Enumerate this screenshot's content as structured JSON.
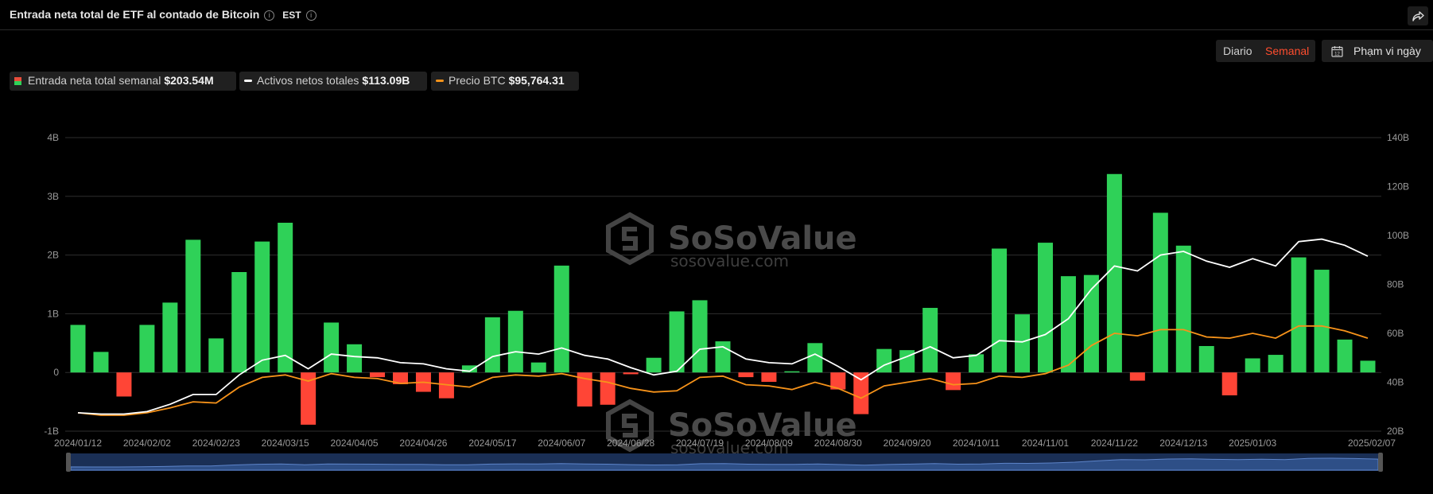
{
  "header": {
    "title": "Entrada neta total de ETF al contado de Bitcoin",
    "timezone": "EST"
  },
  "controls": {
    "daily_label": "Diario",
    "weekly_label": "Semanal",
    "range_label": "Phạm vi ngày",
    "active_color": "#ff4d2e"
  },
  "legend": [
    {
      "label": "Entrada neta total semanal",
      "value": "$203.54M"
    },
    {
      "label": "Activos netos totales",
      "value": "$113.09B"
    },
    {
      "label": "Precio BTC",
      "value": "$95,764.31"
    }
  ],
  "watermark": {
    "brand": "SoSoValue",
    "site": "sosovalue.com"
  },
  "chart_data": {
    "type": "bar",
    "combo": "bar+line",
    "grid": true,
    "legend_position": "top-left",
    "colors": {
      "positive": "#2fd158",
      "negative": "#ff4536",
      "net_assets": "#ffffff",
      "btc_price": "#f7931a"
    },
    "left_axis": {
      "ticks": [
        "4B",
        "3B",
        "2B",
        "1B",
        "0",
        "-1B"
      ],
      "min": -1,
      "max": 4,
      "unit": "B"
    },
    "right_axis": {
      "ticks": [
        "140B",
        "120B",
        "100B",
        "80B",
        "60B",
        "40B",
        "20B"
      ],
      "min": 20,
      "max": 140,
      "unit": "B"
    },
    "x_tick_labels": [
      "2024/01/12",
      "2024/02/02",
      "2024/02/23",
      "2024/03/15",
      "2024/04/05",
      "2024/04/26",
      "2024/05/17",
      "2024/06/07",
      "2024/06/28",
      "2024/07/19",
      "2024/08/09",
      "2024/08/30",
      "2024/09/20",
      "2024/10/11",
      "2024/11/01",
      "2024/11/22",
      "2024/12/13",
      "2025/01/03",
      "2025/02/07"
    ],
    "x_tick_weeks": [
      0,
      3,
      6,
      9,
      12,
      15,
      18,
      21,
      24,
      27,
      30,
      33,
      36,
      39,
      42,
      45,
      48,
      51,
      56
    ],
    "series": [
      {
        "name": "Entrada neta total semanal",
        "axis": "left",
        "values": [
          0.81,
          0.35,
          -0.41,
          0.81,
          1.19,
          2.26,
          0.58,
          1.71,
          2.23,
          2.55,
          -0.89,
          0.85,
          0.48,
          -0.08,
          -0.2,
          -0.33,
          -0.44,
          0.12,
          0.94,
          1.05,
          0.17,
          1.82,
          -0.58,
          -0.55,
          -0.03,
          0.25,
          1.04,
          1.23,
          0.53,
          -0.08,
          -0.16,
          0.02,
          0.5,
          -0.29,
          -0.71,
          0.4,
          0.38,
          1.1,
          -0.3,
          0.31,
          2.11,
          0.99,
          2.21,
          1.64,
          1.66,
          3.38,
          -0.14,
          2.72,
          2.16,
          0.45,
          -0.39,
          0.24,
          0.3,
          1.96,
          1.75,
          0.56,
          0.2
        ]
      },
      {
        "name": "Activos netos totales",
        "axis": "right",
        "values": [
          27.5,
          27,
          27,
          28,
          31,
          35,
          35,
          43,
          49,
          51,
          45.5,
          51.5,
          50.5,
          50,
          48,
          47.5,
          45.5,
          44.5,
          50.5,
          52.5,
          51.5,
          54,
          51,
          49.5,
          46,
          43,
          44.5,
          53.5,
          54.5,
          49.5,
          48,
          47.5,
          51.5,
          46.5,
          41,
          47,
          50.5,
          54.5,
          50,
          51,
          57,
          56.5,
          59.5,
          66,
          78,
          87.5,
          85.5,
          92,
          93.5,
          89.5,
          87,
          90.5,
          87.5,
          97.5,
          98.5,
          96,
          91.5
        ]
      },
      {
        "name": "Precio BTC",
        "axis": "right",
        "values": [
          27.5,
          26.5,
          26.5,
          27.5,
          29.5,
          32,
          31.5,
          38,
          42,
          43,
          40.5,
          43.5,
          42,
          41.5,
          39.5,
          40,
          39,
          38,
          42,
          43,
          42.5,
          43.5,
          41.5,
          40,
          37.5,
          36,
          36.5,
          42,
          42.5,
          39,
          38.5,
          37,
          40,
          37.5,
          33.5,
          38.5,
          40,
          41.5,
          39,
          39.5,
          42.5,
          42,
          43.5,
          47,
          55,
          60,
          59,
          61.5,
          61.5,
          58.5,
          58,
          60,
          58,
          63,
          63,
          61,
          58
        ]
      }
    ]
  }
}
